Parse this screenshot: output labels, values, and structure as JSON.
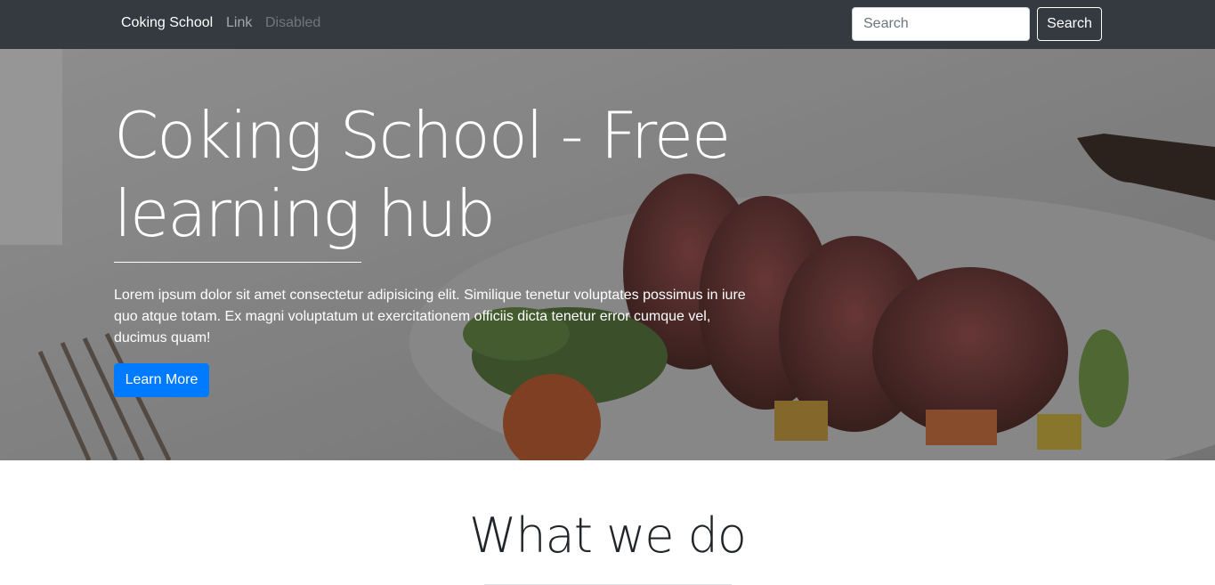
{
  "navbar": {
    "brand": "Coking School",
    "links": [
      "Link",
      "Disabled"
    ],
    "search": {
      "placeholder": "Search",
      "value": ""
    },
    "search_button": "Search"
  },
  "hero": {
    "title": "Coking School - Free learning hub",
    "text": "Lorem ipsum dolor sit amet consectetur adipisicing elit. Similique tenetur voluptates possimus in iure quo atque totam. Ex magni voluptatum ut exercitationem officiis dicta tenetur error cumque vel, ducimus quam!",
    "button": "Learn More"
  },
  "section": {
    "title": "What we do"
  },
  "colors": {
    "navbar_bg": "#343a40",
    "primary": "#007bff",
    "hero_overlay": "#808080"
  }
}
